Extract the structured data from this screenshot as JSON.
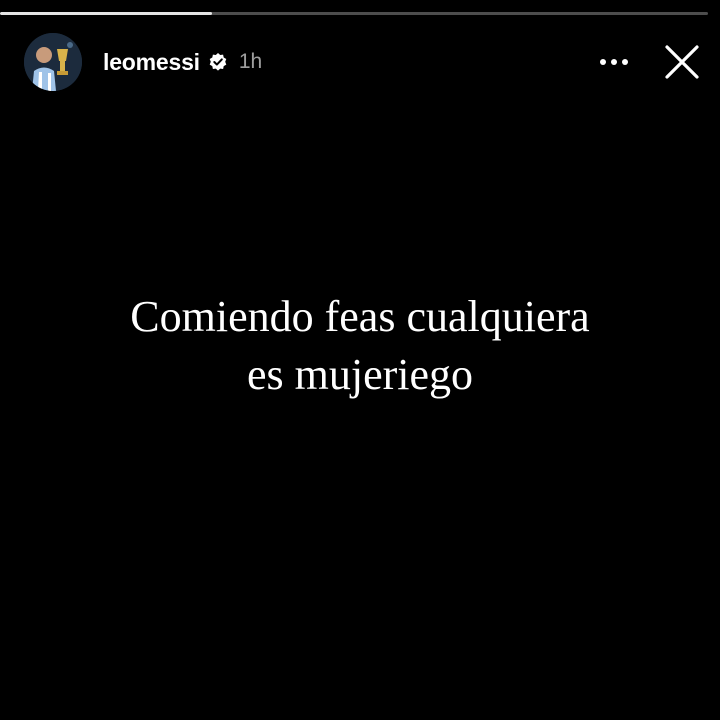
{
  "story": {
    "progress": 0.3,
    "user": {
      "username": "leomessi",
      "verified": true,
      "time": "1h"
    },
    "text_lines": [
      "Comiendo feas cualquiera",
      "es mujeriego"
    ]
  },
  "icons": {
    "more": "more-horizontal-icon",
    "close": "close-icon",
    "verified": "verified-badge-icon"
  },
  "colors": {
    "background": "#000000",
    "text": "#ffffff",
    "muted_text": "#a0a0a0"
  }
}
